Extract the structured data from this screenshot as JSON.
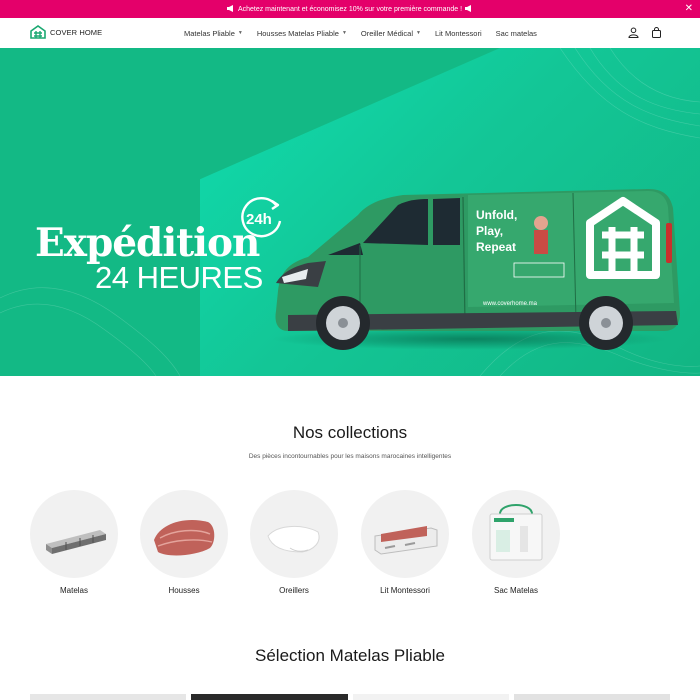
{
  "announcement": {
    "text": "Achetez maintenant et économisez 10% sur votre première commande !",
    "left_icon": "megaphone-icon",
    "right_icon": "megaphone-icon"
  },
  "brand": {
    "name": "COVER HOME",
    "accent": "#1aa871",
    "bar_color": "#e4006a"
  },
  "nav": {
    "items": [
      {
        "label": "Matelas Pliable",
        "dropdown": true
      },
      {
        "label": "Housses Matelas Pliable",
        "dropdown": true
      },
      {
        "label": "Oreiller Médical",
        "dropdown": true
      },
      {
        "label": "Lit Montessori",
        "dropdown": false
      },
      {
        "label": "Sac matelas",
        "dropdown": false
      }
    ]
  },
  "hero": {
    "title_line1": "Expédition",
    "title_line2": "24 HEURES",
    "badge": "24h",
    "van_slogan": [
      "Unfold,",
      "Play,",
      "Repeat"
    ],
    "van_url": "www.coverhome.ma",
    "bg_color": "#13b985"
  },
  "collections": {
    "title": "Nos collections",
    "subtitle": "Des pièces incontournables pour les maisons marocaines intelligentes",
    "items": [
      {
        "label": "Matelas"
      },
      {
        "label": "Housses"
      },
      {
        "label": "Oreillers"
      },
      {
        "label": "Lit Montessori"
      },
      {
        "label": "Sac Matelas"
      }
    ]
  },
  "selection": {
    "title": "Sélection Matelas Pliable"
  }
}
